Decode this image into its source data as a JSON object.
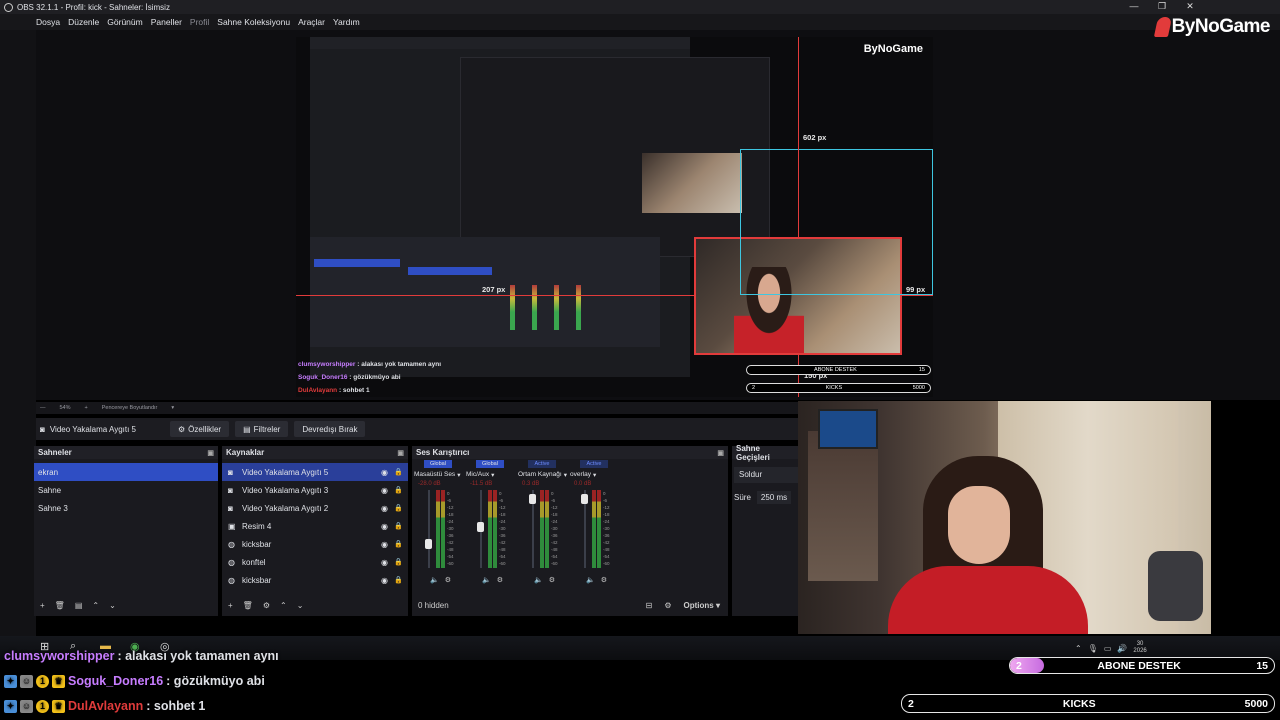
{
  "window": {
    "title": "OBS 32.1.1 - Profil: kick - Sahneler: İsimsiz",
    "minimize": "—",
    "restore": "❐",
    "close": "✕"
  },
  "menu": {
    "items": [
      "Dosya",
      "Düzenle",
      "Görünüm",
      "Paneller",
      "Profil",
      "Sahne Koleksiyonu",
      "Araçlar",
      "Yardım"
    ]
  },
  "logo": {
    "text": "ByNoGame"
  },
  "preview": {
    "labels": {
      "w": "602 px",
      "left": "207 px",
      "right": "99 px",
      "bottom": "150 px"
    },
    "logo": "ByNoGame",
    "chat": [
      {
        "user": "clumsyworshipper",
        "msg": " : alakası yok tamamen aynı"
      },
      {
        "user": "Soguk_Doner16",
        "msg": " : gözükmüyo abi"
      },
      {
        "user": "DulAvlayann",
        "msg": " : sohbet 1"
      }
    ],
    "goal1": {
      "left": "",
      "label": "ABONE DESTEK",
      "value": "15"
    },
    "goal2": {
      "left": "2",
      "label": "KICKS",
      "value": "5000"
    }
  },
  "zoom": {
    "value": "54%",
    "fit": "Pencereye Boyutlandır"
  },
  "source_bar": {
    "name": "Video Yakalama Aygıtı 5",
    "properties": "Özellikler",
    "filters": "Filtreler",
    "deactivate": "Devredışı Bırak"
  },
  "scenes": {
    "title": "Sahneler",
    "items": [
      "ekran",
      "Sahne",
      "Sahne 3"
    ]
  },
  "sources": {
    "title": "Kaynaklar",
    "items": [
      {
        "name": "Video Yakalama Aygıtı 5",
        "icon": "camera-icon"
      },
      {
        "name": "Video Yakalama Aygıtı 3",
        "icon": "camera-icon"
      },
      {
        "name": "Video Yakalama Aygıtı 2",
        "icon": "camera-icon"
      },
      {
        "name": "Resim 4",
        "icon": "image-icon"
      },
      {
        "name": "kicksbar",
        "icon": "browser-icon"
      },
      {
        "name": "konftel",
        "icon": "browser-icon"
      },
      {
        "name": "kicksbar",
        "icon": "browser-icon"
      }
    ]
  },
  "mixer": {
    "title": "Ses Karıştırıcı",
    "channels": [
      {
        "tag": "Global",
        "name": "Masaüstü Ses",
        "db": "-28.0 dB",
        "level": 0.3
      },
      {
        "tag": "Global",
        "name": "Mic/Aux",
        "db": "-11.5 dB",
        "level": 0.55
      },
      {
        "tag": "Active",
        "name": "Ortam Kaynağı",
        "db": "0.3 dB",
        "level": 0.95
      },
      {
        "tag": "Active",
        "name": "overlay",
        "db": "0.0 dB",
        "level": 0.95
      }
    ],
    "scale": [
      "0",
      "-6",
      "-12",
      "-18",
      "-24",
      "-30",
      "-36",
      "-42",
      "-48",
      "-54",
      "-60"
    ],
    "hidden": "0 hidden",
    "options": "Options"
  },
  "transitions": {
    "title": "Sahne Geçişleri",
    "type": "Soldur",
    "duration_label": "Süre",
    "duration": "250 ms"
  },
  "taskbar": {
    "year": "2026",
    "day": "30"
  },
  "chat": [
    {
      "user": "clumsyworshipper",
      "color": "#c77dff",
      "msg": " : alakası yok tamamen aynı"
    },
    {
      "user": "Soguk_Doner16",
      "color": "#c77dff",
      "msg": " : gözükmüyo abi"
    },
    {
      "user": "DulAvlayann",
      "color": "#e03b3b",
      "msg": " : sohbet 1"
    }
  ],
  "goals": {
    "sub": {
      "left": "2",
      "label": "ABONE DESTEK",
      "value": "15",
      "progress": 0.13
    },
    "kicks": {
      "left": "2",
      "label": "KICKS",
      "value": "5000"
    }
  },
  "colors": {
    "accent": "#2f4ec4",
    "guide_red": "#e23b3b",
    "guide_cyan": "#3ec6e0"
  }
}
